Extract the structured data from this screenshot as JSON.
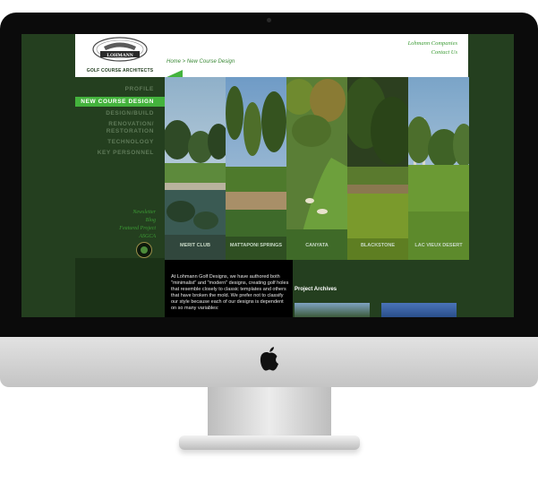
{
  "logo": {
    "name": "LOHMANN",
    "tagline": "GOLF COURSE ARCHITECTS"
  },
  "breadcrumb": {
    "home": "Home",
    "separator": " > ",
    "current": "New Course Design"
  },
  "top_links": [
    "Lohmann Companies",
    "Contact Us"
  ],
  "nav": [
    {
      "label": "PROFILE",
      "active": false
    },
    {
      "label": "NEW COURSE DESIGN",
      "active": true
    },
    {
      "label": "DESIGN/BUILD",
      "active": false
    },
    {
      "label": "RENOVATION/\nRESTORATION",
      "active": false
    },
    {
      "label": "TECHNOLOGY",
      "active": false
    },
    {
      "label": "KEY PERSONNEL",
      "active": false
    }
  ],
  "sub_links": [
    "Newsletter",
    "Blog",
    "Featured Project",
    "ASGCA"
  ],
  "gallery": [
    {
      "label": "MERIT CLUB"
    },
    {
      "label": "MATTAPONI\nSPRINGS"
    },
    {
      "label": "CANYATA"
    },
    {
      "label": "BLACKSTONE"
    },
    {
      "label": "LAC VIEUX DESERT"
    }
  ],
  "intro_text": "At Lohmann Golf Designs, we have authored both \"minimalist\" and \"modern\" designs, creating golf holes that resemble closely to classic templates and others that have broken the mold. We prefer not to classify our style because each of our designs is dependent on so many variables:",
  "archives_title": "Project Archives",
  "colors": {
    "accent": "#44b33d",
    "background": "#243f1f",
    "link": "#3c9b35"
  }
}
